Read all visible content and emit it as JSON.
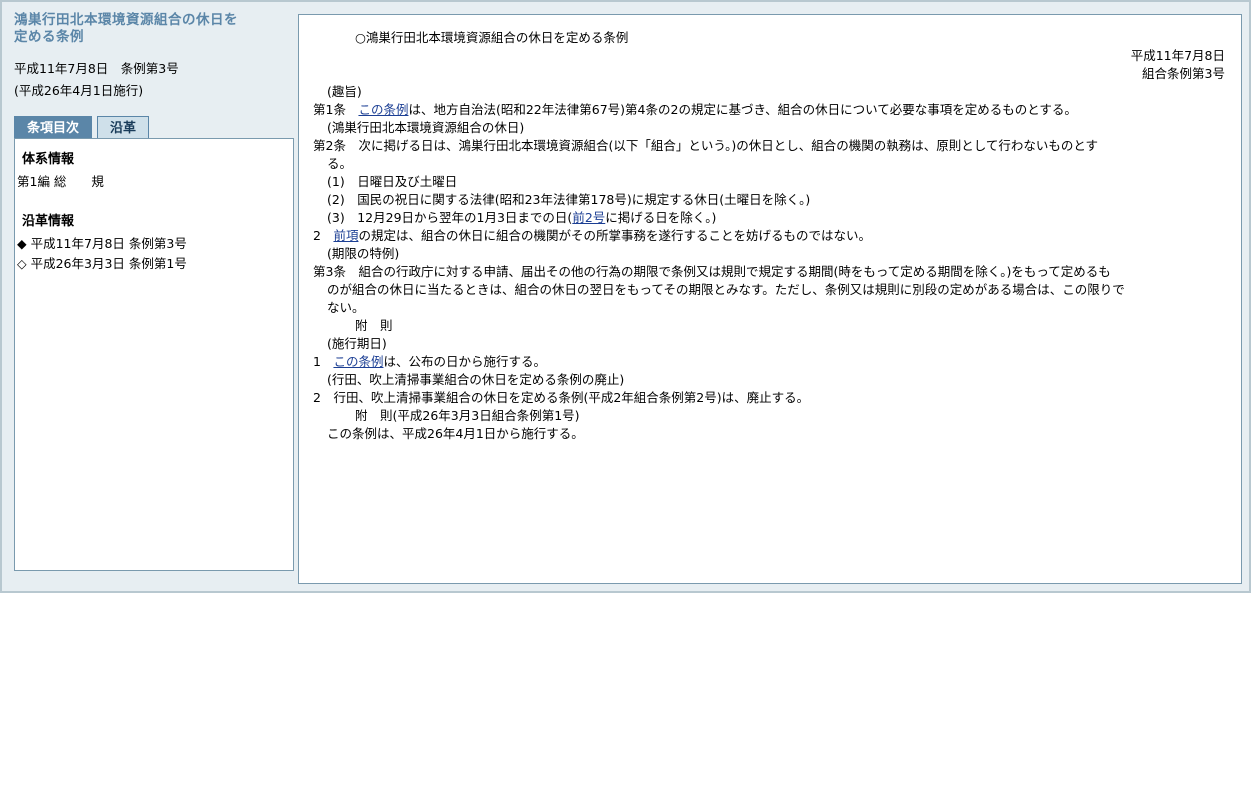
{
  "sidebar": {
    "title_line1": "鴻巣行田北本環境資源組合の休日を",
    "title_line2": "定める条例",
    "meta_line1": "平成11年7月8日　条例第3号",
    "meta_line2": "(平成26年4月1日施行)",
    "tabs": [
      {
        "label": "条項目次",
        "active": true
      },
      {
        "label": "沿革",
        "active": false
      }
    ],
    "taikei_title": "体系情報",
    "taikei_item": "第1編 総　　規",
    "enkaku_title": "沿革情報",
    "enkaku_items": [
      "◆ 平成11年7月8日 条例第3号",
      "◇ 平成26年3月3日 条例第1号"
    ]
  },
  "main": {
    "heading": "○鴻巣行田北本環境資源組合の休日を定める条例",
    "date": "平成11年7月8日",
    "number": "組合条例第3号",
    "lines": [
      {
        "t": "(趣旨)"
      },
      {
        "p": "第1条　",
        "link": "この条例",
        "t": "は、地方自治法(昭和22年法律第67号)第4条の2の規定に基づき、組合の休日について必要な事項を定めるものとする。"
      },
      {
        "t": "(鴻巣行田北本環境資源組合の休日)"
      },
      {
        "t": "第2条　次に掲げる日は、鴻巣行田北本環境資源組合(以下「組合」という。)の休日とし、組合の機関の執務は、原則として行わないものとす"
      },
      {
        "t": "る。"
      },
      {
        "t": "(1)　日曜日及び土曜日"
      },
      {
        "t": "(2)　国民の祝日に関する法律(昭和23年法律第178号)に規定する休日(土曜日を除く。)"
      },
      {
        "p": "(3)　12月29日から翌年の1月3日までの日(",
        "link": "前2号",
        "t": "に掲げる日を除く。)"
      },
      {
        "p": "2　",
        "link": "前項",
        "t": "の規定は、組合の休日に組合の機関がその所掌事務を遂行することを妨げるものではない。"
      },
      {
        "t": "(期限の特例)"
      },
      {
        "t": "第3条　組合の行政庁に対する申請、届出その他の行為の期限で条例又は規則で規定する期間(時をもって定める期間を除く。)をもって定めるも"
      },
      {
        "t": "のが組合の休日に当たるときは、組合の休日の翌日をもってその期限とみなす。ただし、条例又は規則に別段の定めがある場合は、この限りで"
      },
      {
        "t": "ない。"
      },
      {
        "t": "附　則"
      },
      {
        "t": "(施行期日)"
      },
      {
        "p": "1　",
        "link": "この条例",
        "t": "は、公布の日から施行する。"
      },
      {
        "t": "(行田、吹上清掃事業組合の休日を定める条例の廃止)"
      },
      {
        "t": "2　行田、吹上清掃事業組合の休日を定める条例(平成2年組合条例第2号)は、廃止する。"
      },
      {
        "t": "附　則(平成26年3月3日組合条例第1号)"
      },
      {
        "t": "この条例は、平成26年4月1日から施行する。"
      }
    ]
  }
}
